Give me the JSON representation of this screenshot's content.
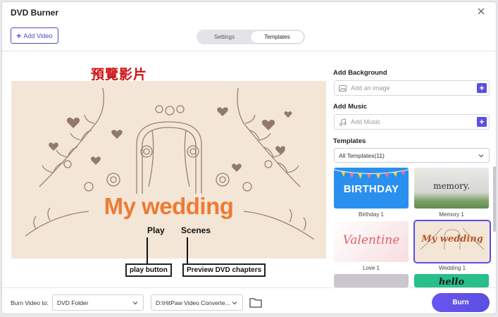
{
  "window": {
    "title": "DVD Burner"
  },
  "toolbar": {
    "add_video_label": "Add Video"
  },
  "tabs": [
    {
      "label": "Settings",
      "active": false
    },
    {
      "label": "Templates",
      "active": true
    }
  ],
  "annotations": {
    "preview_heading": "預覽影片",
    "play_label": "Play",
    "scenes_label": "Scenes",
    "play_callout": "play button",
    "scenes_callout": "Preview DVD chapters"
  },
  "preview": {
    "title_text": "My wedding"
  },
  "sidebar": {
    "background": {
      "heading": "Add Background",
      "placeholder": "Add an image"
    },
    "music": {
      "heading": "Add Music",
      "placeholder": "Add Music"
    },
    "templates": {
      "heading": "Templates",
      "filter": "All Templates(11)",
      "items": [
        {
          "caption": "Birthday 1",
          "thumb_text": "BIRTHDAY",
          "selected": false
        },
        {
          "caption": "Memory 1",
          "thumb_text": "memory.",
          "selected": false
        },
        {
          "caption": "Love 1",
          "thumb_text": "Valentine",
          "selected": false
        },
        {
          "caption": "Wedding 1",
          "thumb_text": "My wedding",
          "selected": true
        },
        {
          "caption": "",
          "thumb_text": "",
          "selected": false
        },
        {
          "caption": "",
          "thumb_text": "hello",
          "selected": false
        }
      ]
    }
  },
  "footer": {
    "burn_to_label": "Burn Video to:",
    "target": "DVD Folder",
    "path": "D:\\HitPaw Video Converte...",
    "burn_label": "Burn"
  },
  "colors": {
    "accent": "#5a4fe0",
    "preview_bg": "#f3e6d6",
    "wedding_title": "#ee7a34",
    "annotation_red": "#d11010"
  }
}
